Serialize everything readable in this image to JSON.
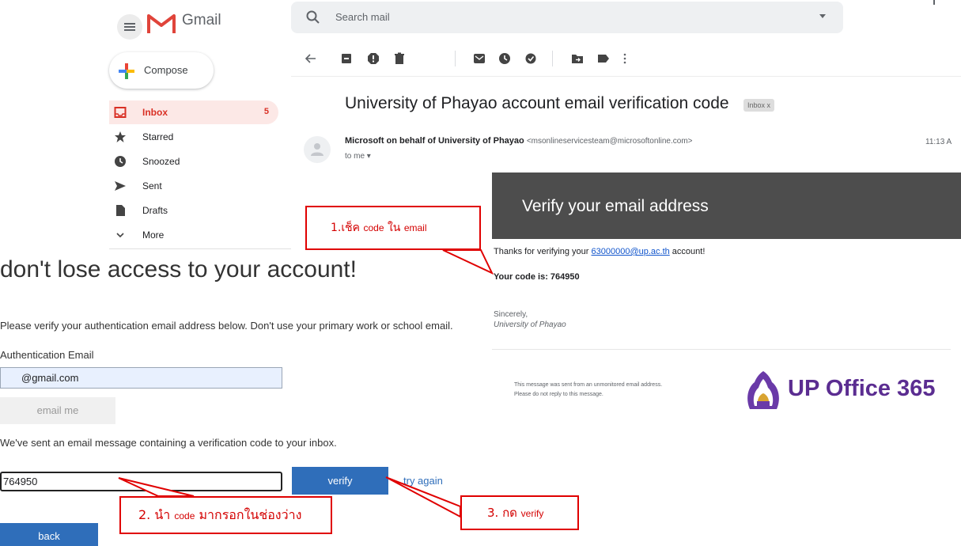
{
  "gmail": {
    "app_name": "Gmail",
    "search_placeholder": "Search mail",
    "compose_label": "Compose",
    "nav": [
      {
        "label": "Inbox",
        "count": "5",
        "icon": "inbox-icon"
      },
      {
        "label": "Starred",
        "icon": "star-icon"
      },
      {
        "label": "Snoozed",
        "icon": "clock-icon"
      },
      {
        "label": "Sent",
        "icon": "send-icon"
      },
      {
        "label": "Drafts",
        "icon": "draft-icon"
      },
      {
        "label": "More",
        "icon": "chevron-down-icon"
      }
    ],
    "toolbar_icons": [
      "back-arrow-icon",
      "archive-icon",
      "report-spam-icon",
      "delete-icon",
      "mark-unread-icon",
      "snooze-icon",
      "add-task-icon",
      "move-to-icon",
      "label-icon",
      "more-icon"
    ]
  },
  "email": {
    "subject": "University of Phayao account email verification code",
    "inbox_tag": "Inbox x",
    "sender_name": "Microsoft on behalf of University of Phayao",
    "sender_email": "<msonlineservicesteam@microsoftonline.com>",
    "time": "11:13 A",
    "to_me": "to me ▾",
    "banner_title": "Verify your email address",
    "thanks_prefix": "Thanks for verifying your ",
    "thanks_link": "63000000@up.ac.th",
    "thanks_suffix": " account!",
    "code_line": "Your code is: 764950",
    "sincerely": "Sincerely,",
    "signature": "University of Phayao",
    "footer_line1": "This message was sent from an unmonitored email address.",
    "footer_line2": "Please do not reply to this message.",
    "brand": "UP Office 365",
    "brand_color": "#5b2d91"
  },
  "form": {
    "heading": "don't lose access to your account!",
    "instructions": "Please verify your authentication email address below. Don't use your primary work or school email.",
    "auth_label": "Authentication Email",
    "auth_value": "@gmail.com",
    "email_me": "email me",
    "sent_text": "We've sent an email message containing a verification code to your inbox.",
    "code_value": "764950",
    "verify": "verify",
    "try_again": "try again",
    "back": "back",
    "button_color": "#2f6eba"
  },
  "annotations": {
    "step1": {
      "a": "1.เช็ค ",
      "b": "code",
      "c": " ใน ",
      "d": "email"
    },
    "step2": {
      "a": "2. นำ ",
      "b": "code",
      "c": " มากรอกในช่องว่าง"
    },
    "step3": {
      "a": "3. กด ",
      "b": "verify"
    },
    "color": "#e00000"
  }
}
